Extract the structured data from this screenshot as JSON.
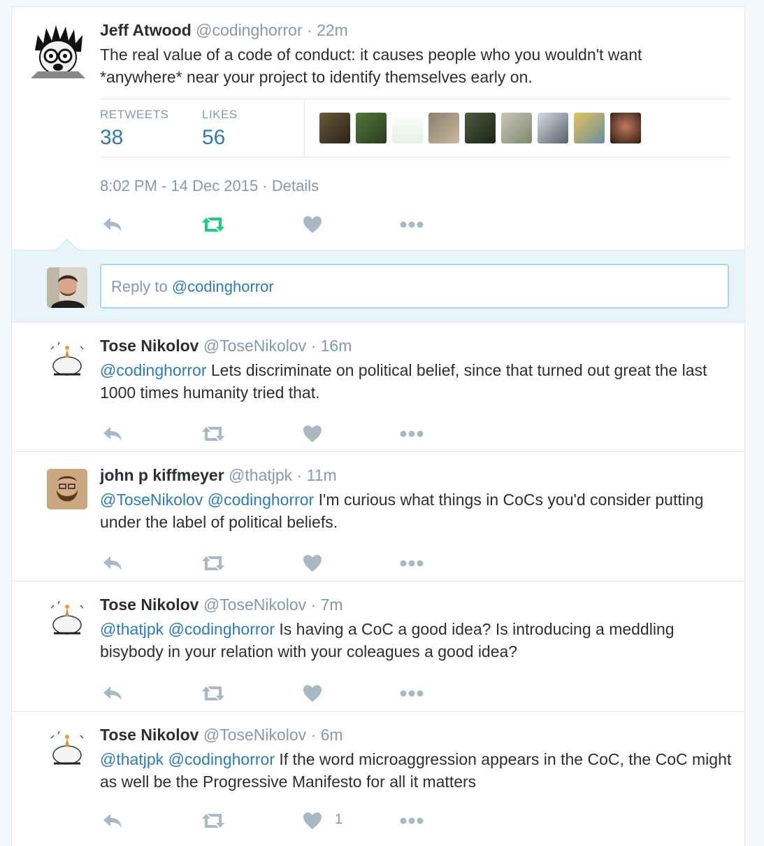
{
  "main_tweet": {
    "name": "Jeff Atwood",
    "handle": "@codinghorror",
    "time": "22m",
    "text": "The real value of a code of conduct: it causes people who you wouldn't want *anywhere* near your project to identify themselves early on.",
    "retweets_label": "RETWEETS",
    "retweets_count": "38",
    "likes_label": "LIKES",
    "likes_count": "56",
    "timestamp": "8:02 PM - 14 Dec 2015",
    "details_link": "Details"
  },
  "reply_box": {
    "placeholder_prefix": "Reply to ",
    "placeholder_mention": "@codinghorror"
  },
  "replies": [
    {
      "name": "Tose Nikolov",
      "handle": "@ToseNikolov",
      "time": "16m",
      "mentions": [
        "@codinghorror"
      ],
      "text": "Lets discriminate on political belief, since that turned out great the last 1000 times humanity tried that.",
      "like_count": ""
    },
    {
      "name": "john p kiffmeyer",
      "handle": "@thatjpk",
      "time": "11m",
      "mentions": [
        "@ToseNikolov",
        "@codinghorror"
      ],
      "text": "I'm curious what things in CoCs you'd consider putting under the label of political beliefs.",
      "like_count": ""
    },
    {
      "name": "Tose Nikolov",
      "handle": "@ToseNikolov",
      "time": "7m",
      "mentions": [
        "@thatjpk",
        "@codinghorror"
      ],
      "text": "Is having a CoC a good idea? Is introducing a meddling bisybody in your relation with your coleagues a good idea?",
      "like_count": ""
    },
    {
      "name": "Tose Nikolov",
      "handle": "@ToseNikolov",
      "time": "6m",
      "mentions": [
        "@thatjpk",
        "@codinghorror"
      ],
      "text": "If the word microaggression appears in the CoC, the CoC might as well be the Progressive Manifesto for all it matters",
      "like_count": "1"
    }
  ],
  "colors": {
    "link": "#2b7bb9",
    "muted": "#8899a6",
    "retweeted_green": "#19cf86",
    "icon_gray": "#aab8c2",
    "reply_box_bg": "#e8f4fa"
  }
}
